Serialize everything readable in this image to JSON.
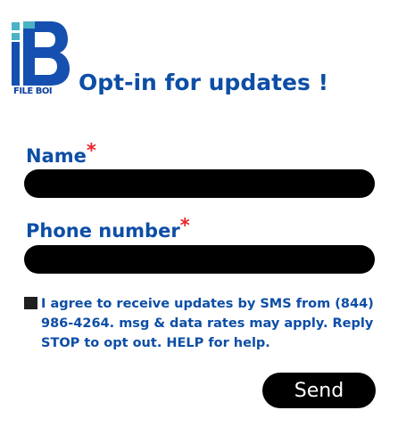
{
  "logo": {
    "text": "FILE BOI",
    "colors": {
      "primary": "#1550b0",
      "accent": "#4ab3c4",
      "dark": "#0d3f9f"
    }
  },
  "form": {
    "title": "Opt-in for updates !",
    "name_label": "Name",
    "phone_label": "Phone number",
    "required_marker": "*",
    "name_value": "",
    "phone_value": "",
    "consent_checked": false,
    "consent_text": "I agree to receive updates by SMS from (844)\n986-4264. msg & data rates may apply. Reply\nSTOP to opt out. HELP for help.",
    "send_label": "Send"
  },
  "colors": {
    "heading": "#0d4ea6",
    "required": "#e8262b",
    "input_bg": "#000000",
    "button_bg": "#000000",
    "button_text": "#ffffff"
  }
}
